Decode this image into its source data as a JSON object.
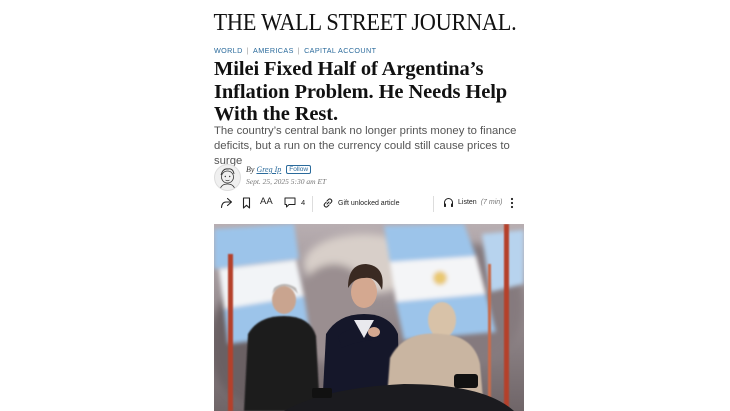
{
  "masthead": "THE WALL STREET JOURNAL.",
  "breadcrumbs": [
    "World",
    "Americas",
    "Capital Account"
  ],
  "headline": "Milei Fixed Half of Argentina’s Inflation Problem. He Needs Help With the Rest.",
  "dek": "The country’s central bank no longer prints money to finance deficits, but a run on the currency could still cause prices to surge",
  "byline": {
    "prefix": "By",
    "author": "Greg Ip",
    "follow_label": "Follow",
    "date": "Sept. 25, 2025 5:30 am ET"
  },
  "toolbar": {
    "font_label": "AA",
    "comment_count": "4",
    "gift_label": "Gift unlocked article",
    "listen_label": "Listen",
    "listen_duration": "(7 min)"
  },
  "icons": [
    "share-icon",
    "bookmark-icon",
    "comment-icon",
    "gift-link-icon",
    "headphones-icon",
    "more-icon"
  ],
  "colors": {
    "link": "#2a6a9b",
    "flag_blue": "#8fb9e0"
  }
}
